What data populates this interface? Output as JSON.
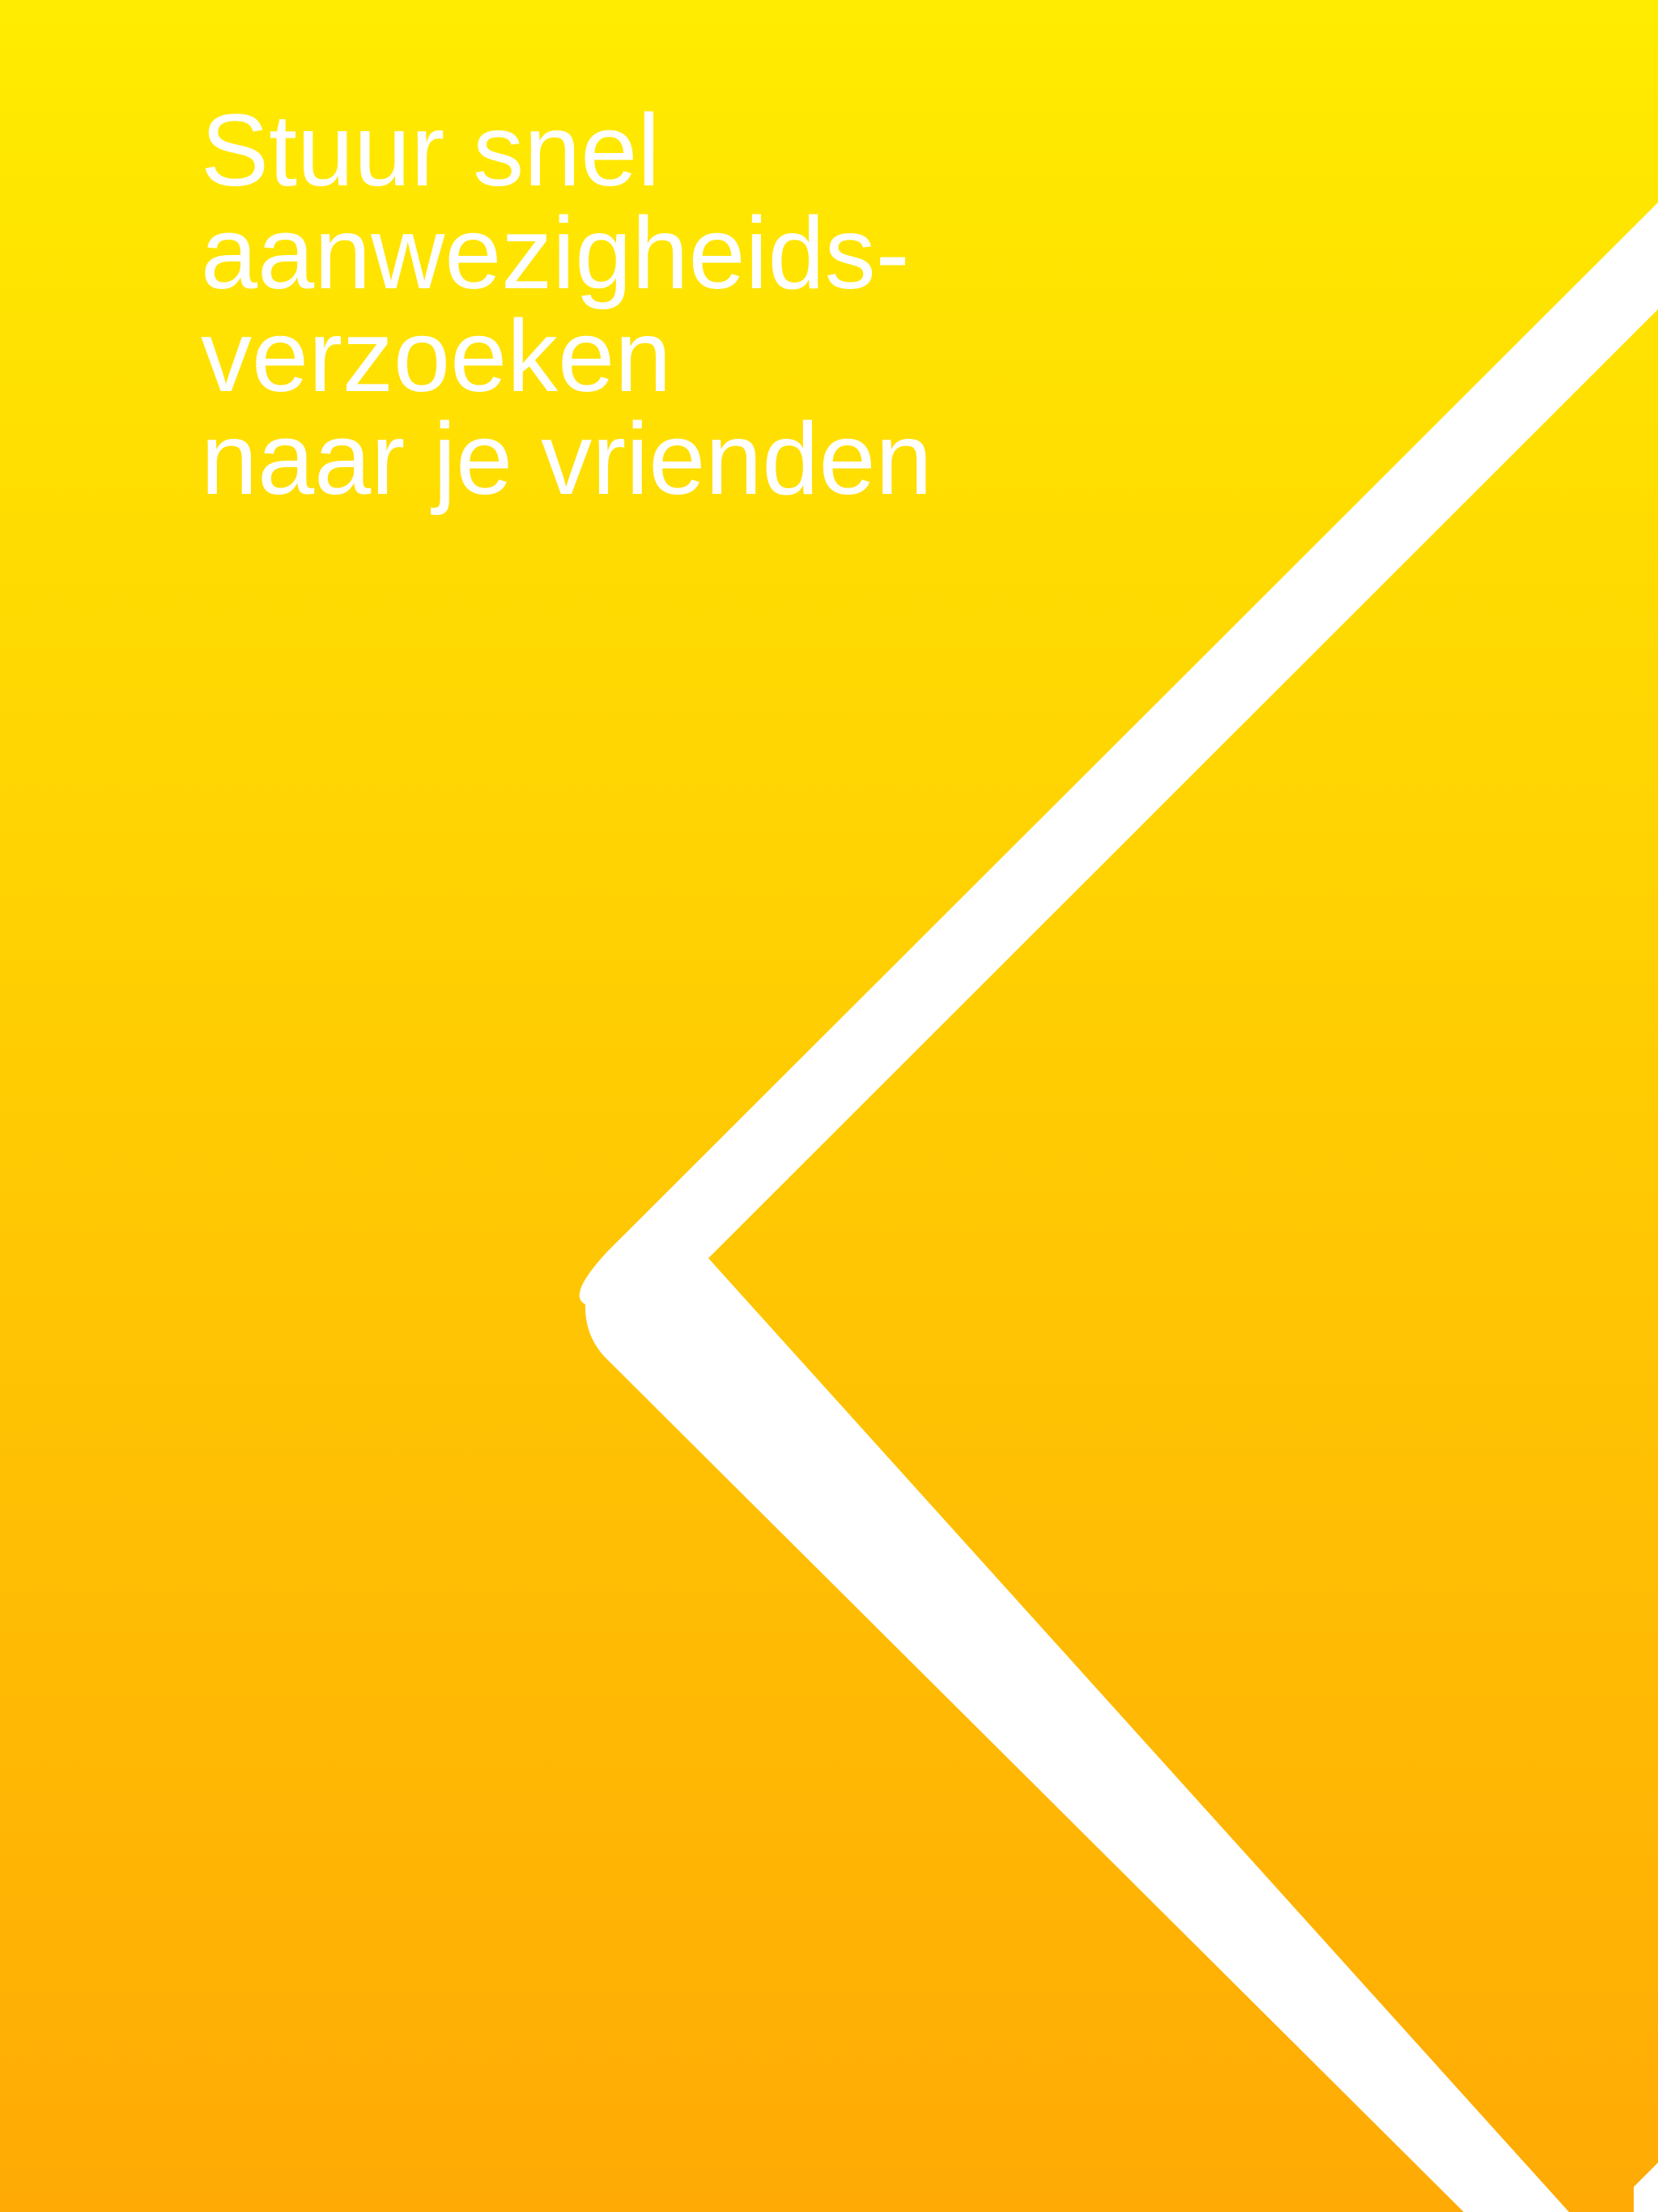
{
  "screen": {
    "headline_lines": [
      "Stuur snel",
      "aanwezigheids-",
      "verzoeken",
      "naar je vrienden"
    ]
  },
  "colors": {
    "gradient_top": "#ffec00",
    "gradient_bottom": "#ffaa05",
    "text": "#ffffff",
    "chevron": "#ffffff"
  },
  "decoration": {
    "icon": "chevron-left-icon"
  }
}
